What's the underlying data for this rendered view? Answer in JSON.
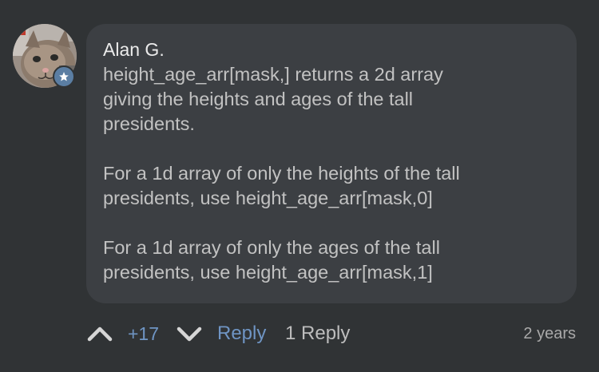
{
  "comment": {
    "author": "Alan G.",
    "paragraphs": [
      "height_age_arr[mask,] returns a 2d array\ngiving the heights and ages of the tall\npresidents.",
      "For a 1d array of only the heights of the tall\npresidents, use height_age_arr[mask,0]",
      "For a 1d array of only the ages of the tall\npresidents, use height_age_arr[mask,1]"
    ],
    "avatar": "cat-photo",
    "badge_icon": "star-icon"
  },
  "actions": {
    "upvote_icon": "chevron-up-icon",
    "vote_count": "+17",
    "downvote_icon": "chevron-down-icon",
    "reply_label": "Reply",
    "replies_label": "1 Reply",
    "timestamp": "2 years"
  },
  "colors": {
    "background": "#303335",
    "bubble": "#3c3f43",
    "accent": "#6f95c4",
    "badge": "#5b7ea3"
  }
}
